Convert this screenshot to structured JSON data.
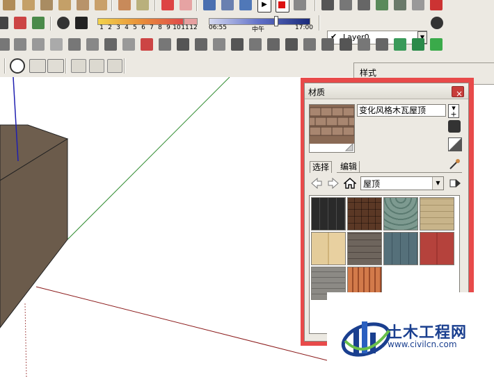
{
  "toolbar": {
    "time_scale_ticks": [
      "1",
      "2",
      "3",
      "4",
      "5",
      "6",
      "7",
      "8",
      "9",
      "10",
      "11",
      "12"
    ],
    "time_start": "06:55",
    "time_mid": "中午",
    "time_end": "17:00",
    "layer_name": "Layer0",
    "layer_check": "✔"
  },
  "styles_window": {
    "title": "样式"
  },
  "materials_window": {
    "title": "材质",
    "close_glyph": "×",
    "material_name": "变化风格木瓦屋顶",
    "tabs": [
      "选择",
      "编辑"
    ],
    "collection": "屋顶",
    "swatches": [
      {
        "name": "slate-shingles",
        "color": "#3a3a3a"
      },
      {
        "name": "wood-shingles-varied",
        "color": "#8a6a55"
      },
      {
        "name": "green-scalloped",
        "color": "#6d8a80"
      },
      {
        "name": "tan-shingles",
        "color": "#c8b48a"
      },
      {
        "name": "sandstone-tiles",
        "color": "#dcc291"
      },
      {
        "name": "gray-shingles",
        "color": "#6e655d"
      },
      {
        "name": "blue-slate",
        "color": "#55707a"
      },
      {
        "name": "red-metal",
        "color": "#b5423c"
      },
      {
        "name": "gray-shakes",
        "color": "#8c8a85"
      },
      {
        "name": "terracotta-tiles",
        "color": "#c0683d"
      }
    ]
  },
  "watermark": {
    "text": "土木工程网",
    "url": "www.civilcn.com"
  },
  "colors": {
    "highlight": "#e84a4a",
    "panel": "#ece9e2",
    "model_box": "#6b5b4b",
    "axis_green": "#2e8b2e",
    "axis_red": "#8b1a1a",
    "axis_blue": "#1f1fb0",
    "watermark_blue": "#1a3f8f"
  }
}
